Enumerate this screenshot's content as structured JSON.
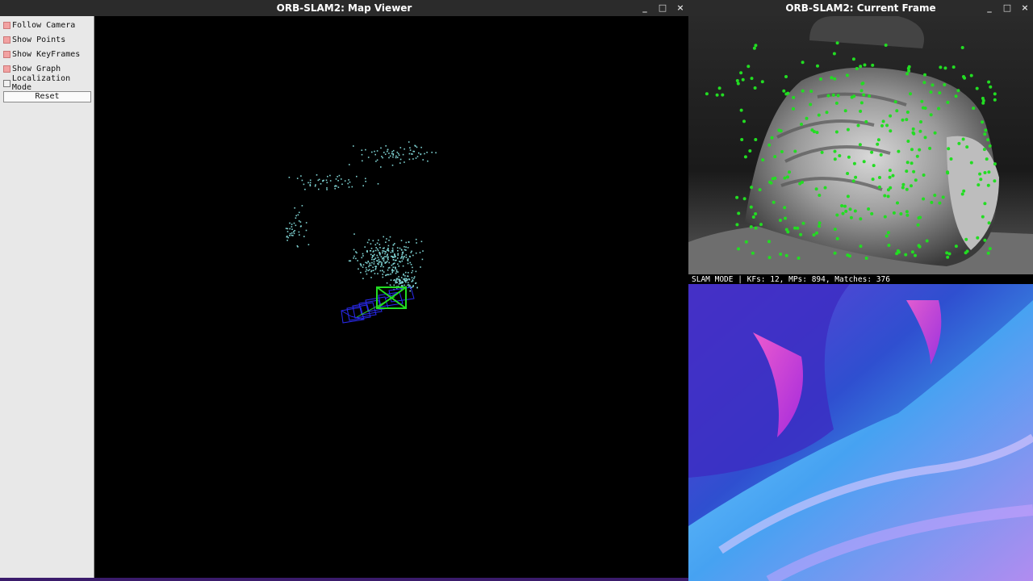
{
  "map_viewer": {
    "title": "ORB-SLAM2: Map Viewer",
    "controls": {
      "minimize": "_",
      "maximize": "□",
      "close": "×"
    },
    "options": [
      {
        "label": "Follow Camera",
        "checked": true
      },
      {
        "label": "Show Points",
        "checked": true
      },
      {
        "label": "Show KeyFrames",
        "checked": true
      },
      {
        "label": "Show Graph",
        "checked": true
      },
      {
        "label": "Localization Mode",
        "checked": false
      }
    ],
    "reset_label": "Reset",
    "colors": {
      "map_points": "#7fd3d3",
      "current_camera": "#22cc22",
      "keyframes": "#2020e0"
    }
  },
  "current_frame": {
    "title": "ORB-SLAM2: Current Frame",
    "controls": {
      "minimize": "_",
      "maximize": "□",
      "close": "×"
    },
    "status": "SLAM MODE |  KFs: 12, MPs: 894, Matches: 376",
    "feature_color": "#22dd22"
  }
}
